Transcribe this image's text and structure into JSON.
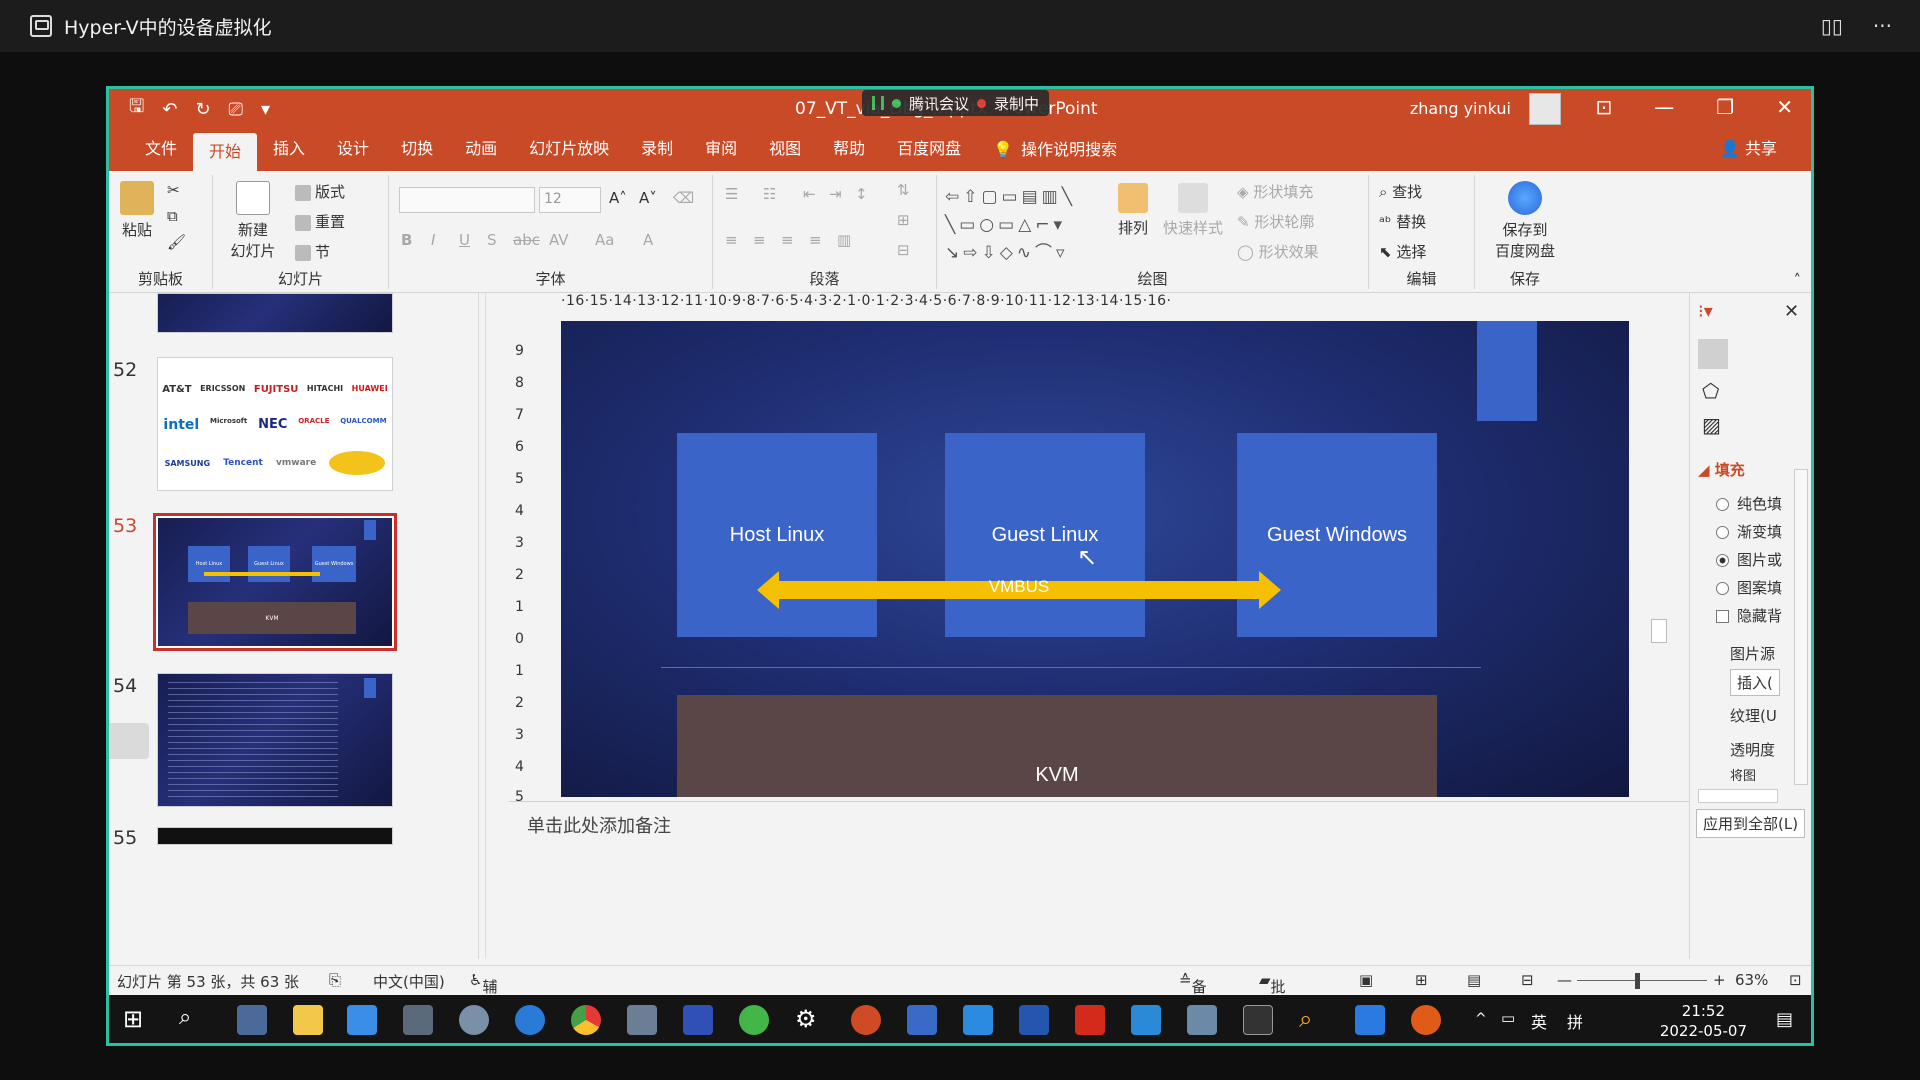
{
  "outer": {
    "title": "Hyper-V中的设备虚拟化",
    "icons": [
      "sidebar-icon",
      "more-icon"
    ]
  },
  "meeting": {
    "app": "腾讯会议",
    "recording": "录制中"
  },
  "ppt": {
    "doc_title": "07_VT_via_Dbg_...pptx - PowerPoint",
    "user": "zhang yinkui",
    "tabs": [
      "文件",
      "开始",
      "插入",
      "设计",
      "切换",
      "动画",
      "幻灯片放映",
      "录制",
      "审阅",
      "视图",
      "帮助",
      "百度网盘"
    ],
    "active_tab": "开始",
    "search_label": "操作说明搜索",
    "share_label": "共享",
    "ribbon": {
      "clipboard": {
        "paste": "粘贴",
        "label": "剪贴板"
      },
      "slides": {
        "new_slide_1": "新建",
        "new_slide_2": "幻灯片",
        "layout": "版式",
        "reset": "重置",
        "section": "节",
        "label": "幻灯片"
      },
      "font": {
        "size": "12",
        "label": "字体"
      },
      "paragraph": {
        "label": "段落"
      },
      "drawing": {
        "arrange": "排列",
        "quick_styles": "快速样式",
        "shape_fill": "形状填充",
        "shape_outline": "形状轮廓",
        "shape_effect": "形状效果",
        "label": "绘图"
      },
      "editing": {
        "find": "查找",
        "replace": "替换",
        "select": "选择",
        "label": "编辑"
      },
      "save": {
        "save_1": "保存到",
        "save_2": "百度网盘",
        "label": "保存"
      }
    },
    "thumbnails": [
      {
        "num": "52",
        "brand_row1": [
          "AT&T",
          "ERICSSON",
          "FUJITSU",
          "HITACHI",
          "HUAWEI"
        ],
        "brand_row2": [
          "intel",
          "Microsoft",
          "NEC",
          "ORACLE",
          "QUALCOMM"
        ],
        "brand_row3": [
          "SAMSUNG",
          "Tencent",
          "vmware"
        ]
      },
      {
        "num": "53",
        "selected": true,
        "mini_labels": [
          "Host Linux",
          "Guest Linux",
          "Guest Windows",
          "KVM"
        ]
      },
      {
        "num": "54"
      },
      {
        "num": "55"
      }
    ],
    "ruler_h": "·16·15·14·13·12·11·10·9·8·7·6·5·4·3·2·1·0·1·2·3·4·5·6·7·8·9·10·11·12·13·14·15·16·",
    "ruler_v": [
      "9",
      "8",
      "7",
      "6",
      "5",
      "4",
      "3",
      "2",
      "1",
      "0",
      "1",
      "2",
      "3",
      "4",
      "5"
    ],
    "slide": {
      "host": "Host Linux",
      "guest_linux": "Guest Linux",
      "guest_windows": "Guest Windows",
      "bus": "VMBUS",
      "kvm": "KVM",
      "colors": {
        "box": "#3a64c7",
        "arrow": "#f5c000",
        "kvm": "#5a4547"
      }
    },
    "notes_placeholder": "单击此处添加备注",
    "format_pane": {
      "section": "填充",
      "options": [
        "纯色填",
        "渐变填",
        "图片或",
        "图案填"
      ],
      "selected": "图片或",
      "hide_bg": "隐藏背",
      "picture_source": "图片源",
      "insert": "插入(",
      "texture": "纹理(U",
      "transparency": "透明度",
      "tile": "将图",
      "apply_all": "应用到全部(L)"
    },
    "status": {
      "slide_info": "幻灯片 第 53 张，共 63 张",
      "language": "中文(中国)",
      "accessibility": "辅助功能: 调查",
      "notes": "备注",
      "comments": "批注",
      "zoom": "63%"
    }
  },
  "taskbar": {
    "time": "21:52",
    "date": "2022-05-07",
    "ime": "英",
    "ime2": "拼"
  }
}
